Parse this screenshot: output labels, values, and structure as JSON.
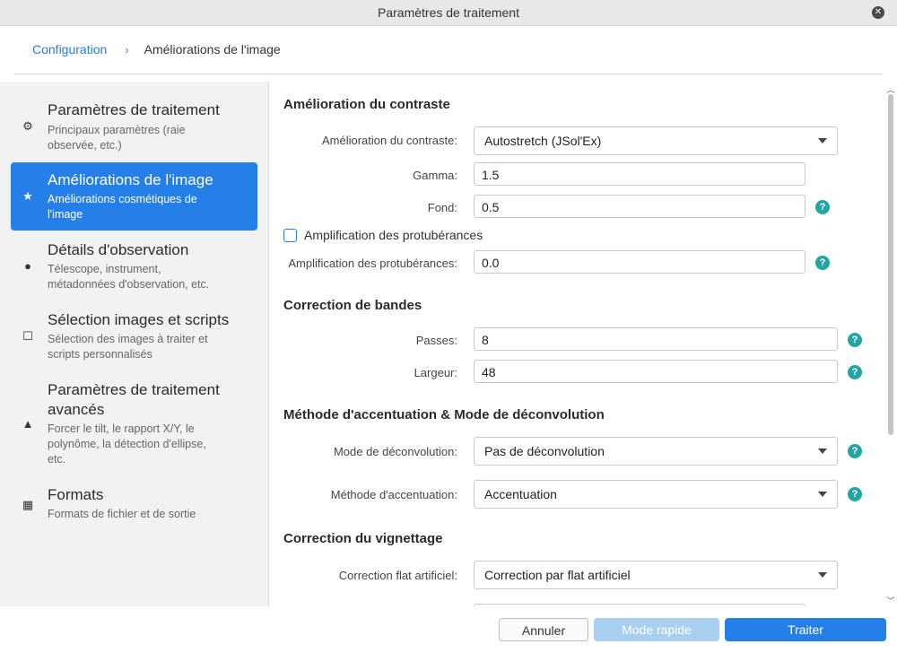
{
  "window": {
    "title": "Paramètres de traitement",
    "close_glyph": "✕"
  },
  "breadcrumb": {
    "root": "Configuration",
    "separator": "›",
    "current": "Améliorations de l'image"
  },
  "sidebar": {
    "items": [
      {
        "icon": "gear-icon",
        "glyph": "⚙",
        "title": "Paramètres de traitement",
        "desc1": "Principaux paramètres (raie",
        "desc2": "observée, etc.)"
      },
      {
        "icon": "star-icon",
        "glyph": "★",
        "title": "Améliorations de l'image",
        "desc1": "Améliorations cosmétiques de",
        "desc2": "l'image"
      },
      {
        "icon": "circle-icon",
        "glyph": "●",
        "title": "Détails d'observation",
        "desc1": "Télescope, instrument,",
        "desc2": "métadonnées d'observation, etc."
      },
      {
        "icon": "square-icon",
        "glyph": "☐",
        "title": "Sélection images et scripts",
        "desc1": "Sélection des images à traiter et",
        "desc2": "scripts personnalisés"
      },
      {
        "icon": "triangle-icon",
        "glyph": "▲",
        "title1": "Paramètres de traitement",
        "title2": "avancés",
        "desc1": "Forcer le tilt, le rapport X/Y, le",
        "desc2": "polynôme, la détection d'ellipse,",
        "desc3": "etc."
      },
      {
        "icon": "grid-icon",
        "glyph": "▦",
        "title": "Formats",
        "desc1": "Formats de fichier et de sortie"
      }
    ]
  },
  "main": {
    "contrast": {
      "title": "Amélioration du contraste",
      "mode_label": "Amélioration du contraste:",
      "mode_value": "Autostretch (JSol'Ex)",
      "gamma_label": "Gamma:",
      "gamma_value": "1.5",
      "fond_label": "Fond:",
      "fond_value": "0.5",
      "prot_checkbox_label": "Amplification des protubérances",
      "prot_label": "Amplification des protubérances:",
      "prot_value": "0.0"
    },
    "banding": {
      "title": "Correction de bandes",
      "passes_label": "Passes:",
      "passes_value": "8",
      "width_label": "Largeur:",
      "width_value": "48"
    },
    "sharpen": {
      "title": "Méthode d'accentuation & Mode de déconvolution",
      "deconv_label": "Mode de déconvolution:",
      "deconv_value": "Pas de déconvolution",
      "sharpen_label": "Méthode d'accentuation:",
      "sharpen_value": "Accentuation"
    },
    "vignette": {
      "title": "Correction du vignettage",
      "flat_label": "Correction flat artificiel:",
      "flat_value": "Correction par flat artificiel"
    },
    "help_glyph": "?"
  },
  "footer": {
    "cancel": "Annuler",
    "quick": "Mode rapide",
    "process": "Traiter"
  },
  "colors": {
    "accent": "#2480e8",
    "help": "#21a5a5",
    "link": "#2b7bd6"
  }
}
